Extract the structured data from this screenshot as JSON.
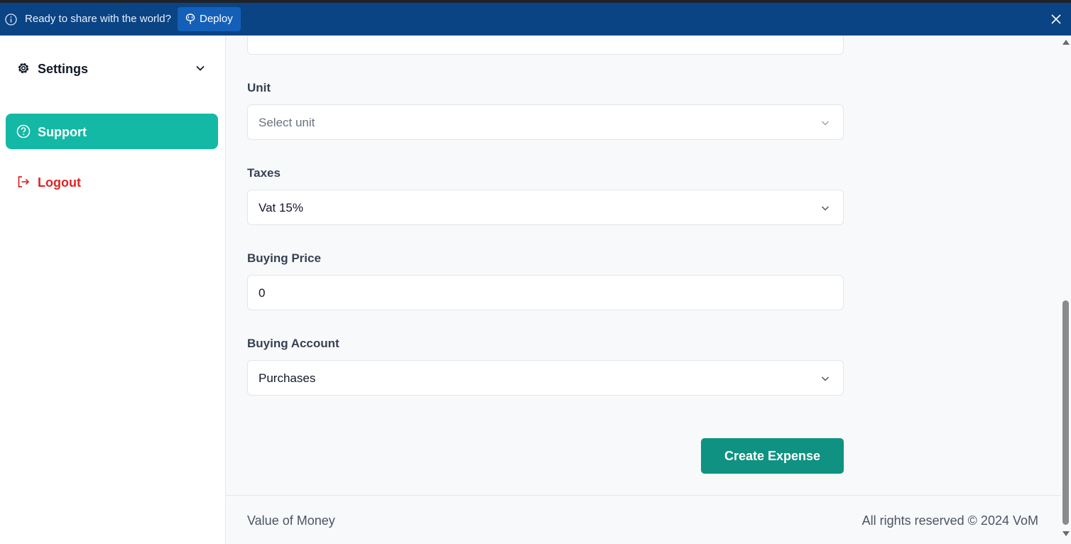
{
  "banner": {
    "message": "Ready to share with the world?",
    "deploy_label": "Deploy",
    "background": "#0a4484"
  },
  "sidebar": {
    "items": [
      {
        "label": "Settings",
        "icon": "gear-icon",
        "has_dropdown": true
      },
      {
        "label": "Support",
        "icon": "question-circle-icon",
        "active": true,
        "color": "#13b9a5"
      },
      {
        "label": "Logout",
        "icon": "logout-icon",
        "color": "#dc2626"
      }
    ]
  },
  "form": {
    "fields": [
      {
        "label": "Unit",
        "type": "select",
        "placeholder": "Select unit",
        "value": ""
      },
      {
        "label": "Taxes",
        "type": "select",
        "value": "Vat 15%"
      },
      {
        "label": "Buying Price",
        "type": "input",
        "value": "0"
      },
      {
        "label": "Buying Account",
        "type": "select",
        "value": "Purchases"
      }
    ],
    "submit_label": "Create Expense",
    "submit_color": "#0f9282"
  },
  "footer": {
    "left": "Value of Money",
    "right": "All rights reserved © 2024 VoM"
  }
}
